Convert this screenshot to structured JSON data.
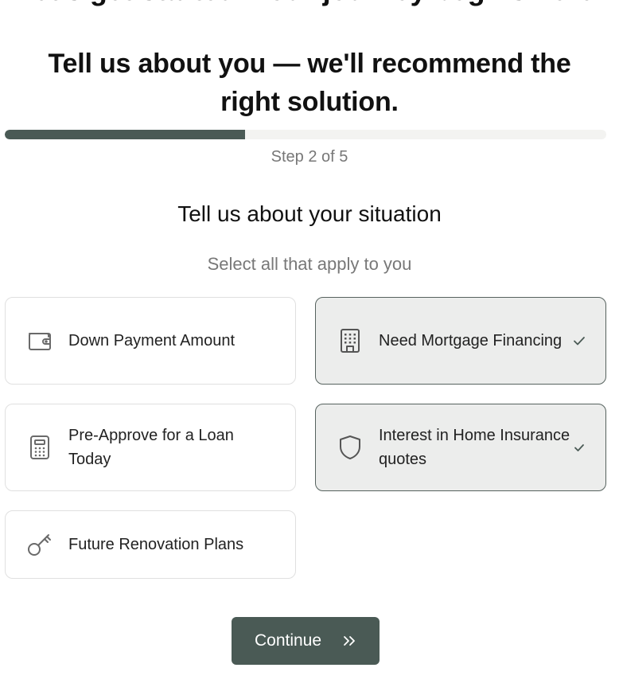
{
  "header": {
    "clipped_title": "Let's get started. Your journey begins here.",
    "hero_title": "Tell us about you — we'll recommend the right solution."
  },
  "progress": {
    "current_step": 2,
    "total_steps": 5,
    "fraction_complete": 0.4,
    "label": "Step 2 of 5",
    "fill_color": "#4a5a55",
    "track_color": "#f3f3f1"
  },
  "section": {
    "title": "Tell us about your situation",
    "subtitle": "Select all that apply to you"
  },
  "options": [
    {
      "label": "Down Payment Amount",
      "icon": "wallet-icon",
      "selected": false
    },
    {
      "label": "Need Mortgage Financing",
      "icon": "building-icon",
      "selected": true
    },
    {
      "label": "Pre-Approve for a Loan Today",
      "icon": "calculator-icon",
      "selected": false
    },
    {
      "label": "Interest in Home Insurance quotes",
      "icon": "shield-icon",
      "selected": true
    },
    {
      "label": "Future Renovation Plans",
      "icon": "key-icon",
      "selected": false
    }
  ],
  "actions": {
    "continue_label": "Continue",
    "continue_icon": "chevrons-right-icon"
  },
  "colors": {
    "accent": "#4a5a55",
    "selected_card_bg": "#ecedec",
    "selected_card_border": "#56625e",
    "card_border": "#e0e0e0"
  }
}
